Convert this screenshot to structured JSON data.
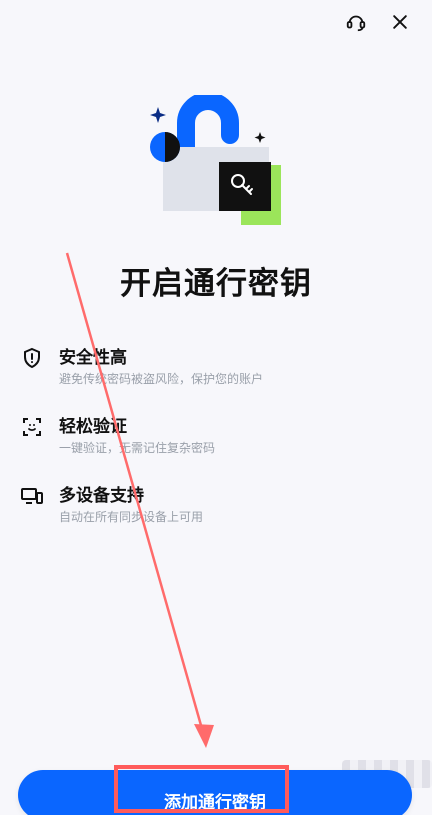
{
  "header": {
    "support_icon": "headset-icon",
    "close_icon": "close-icon"
  },
  "title": "开启通行密钥",
  "features": [
    {
      "icon": "shield-icon",
      "title": "安全性高",
      "description": "避免传统密码被盗风险，保护您的账户"
    },
    {
      "icon": "face-scan-icon",
      "title": "轻松验证",
      "description": "一键验证，无需记住复杂密码"
    },
    {
      "icon": "devices-icon",
      "title": "多设备支持",
      "description": "自动在所有同步设备上可用"
    }
  ],
  "cta": {
    "label": "添加通行密钥"
  },
  "colors": {
    "primary": "#0a66ff",
    "annotation": "#ff5b5b",
    "accent_green": "#9be55a"
  }
}
